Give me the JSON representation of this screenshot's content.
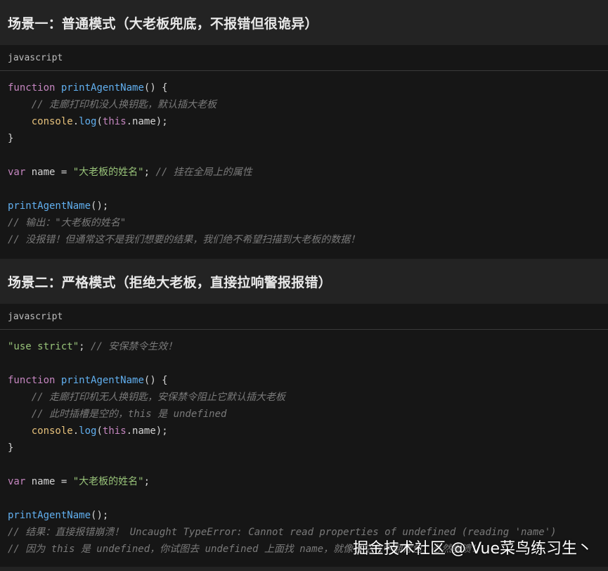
{
  "section1": {
    "title": "场景一：普通模式（大老板兜底，不报错但很诡异）",
    "lang": "javascript",
    "lines": [
      [
        [
          "kw",
          "function"
        ],
        [
          "plain",
          " "
        ],
        [
          "fn",
          "printAgentName"
        ],
        [
          "plain",
          "() {"
        ]
      ],
      [
        [
          "plain",
          "    "
        ],
        [
          "cm",
          "// 走廊打印机没人换钥匙，默认插大老板"
        ]
      ],
      [
        [
          "plain",
          "    "
        ],
        [
          "obj",
          "console"
        ],
        [
          "plain",
          "."
        ],
        [
          "method",
          "log"
        ],
        [
          "plain",
          "("
        ],
        [
          "this",
          "this"
        ],
        [
          "plain",
          ".name);"
        ]
      ],
      [
        [
          "plain",
          "}"
        ]
      ],
      [],
      [
        [
          "kw",
          "var"
        ],
        [
          "plain",
          " name = "
        ],
        [
          "st",
          "\"大老板的姓名\""
        ],
        [
          "plain",
          "; "
        ],
        [
          "cm",
          "// 挂在全局上的属性"
        ]
      ],
      [],
      [
        [
          "fn",
          "printAgentName"
        ],
        [
          "plain",
          "();"
        ]
      ],
      [
        [
          "cm",
          "// 输出：\"大老板的姓名\""
        ]
      ],
      [
        [
          "cm",
          "// 没报错！但通常这不是我们想要的结果，我们绝不希望扫描到大老板的数据！"
        ]
      ]
    ]
  },
  "section2": {
    "title": "场景二：严格模式（拒绝大老板，直接拉响警报报错）",
    "lang": "javascript",
    "lines": [
      [
        [
          "st",
          "\"use strict\""
        ],
        [
          "plain",
          "; "
        ],
        [
          "cm",
          "// 安保禁令生效！"
        ]
      ],
      [],
      [
        [
          "kw",
          "function"
        ],
        [
          "plain",
          " "
        ],
        [
          "fn",
          "printAgentName"
        ],
        [
          "plain",
          "() {"
        ]
      ],
      [
        [
          "plain",
          "    "
        ],
        [
          "cm",
          "// 走廊打印机无人换钥匙，安保禁令阻止它默认插大老板"
        ]
      ],
      [
        [
          "plain",
          "    "
        ],
        [
          "cm",
          "// 此时插槽是空的，this 是 undefined"
        ]
      ],
      [
        [
          "plain",
          "    "
        ],
        [
          "obj",
          "console"
        ],
        [
          "plain",
          "."
        ],
        [
          "method",
          "log"
        ],
        [
          "plain",
          "("
        ],
        [
          "this",
          "this"
        ],
        [
          "plain",
          ".name);"
        ]
      ],
      [
        [
          "plain",
          "}"
        ]
      ],
      [],
      [
        [
          "kw",
          "var"
        ],
        [
          "plain",
          " name = "
        ],
        [
          "st",
          "\"大老板的姓名\""
        ],
        [
          "plain",
          ";"
        ]
      ],
      [],
      [
        [
          "fn",
          "printAgentName"
        ],
        [
          "plain",
          "();"
        ]
      ],
      [
        [
          "cm",
          "// 结果：直接报错崩溃！ Uncaught TypeError: Cannot read properties of undefined (reading 'name')"
        ]
      ],
      [
        [
          "cm",
          "// 因为 this 是 undefined，你试图去 undefined 上面找 name，就像往空气中翻背包，必然崩溃！"
        ]
      ]
    ]
  },
  "watermark": "掘金技术社区 @ Vue菜鸟练习生丶"
}
